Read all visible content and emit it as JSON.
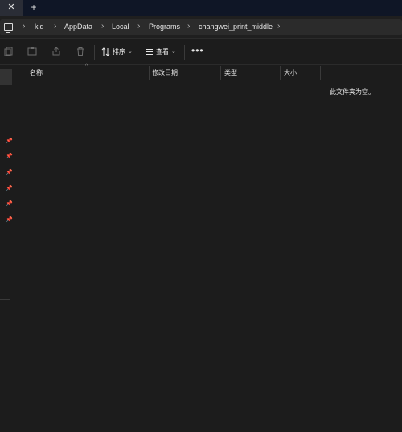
{
  "titlebar": {
    "close_glyph": "✕",
    "new_tab_glyph": "+"
  },
  "address": {
    "icon": "computer-icon",
    "separator": "›",
    "crumbs": [
      "kid",
      "AppData",
      "Local",
      "Programs",
      "changwei_print_middle"
    ]
  },
  "toolbar": {
    "icons": [
      "copy-icon",
      "paste-icon",
      "share-icon",
      "delete-icon"
    ],
    "sort_label": "排序",
    "view_label": "查看",
    "more_label": "•••",
    "caret": "⌄"
  },
  "nav": {
    "pins": [
      "📌",
      "📌",
      "📌",
      "📌",
      "📌",
      "📌"
    ]
  },
  "columns": {
    "name": "名称",
    "modified": "修改日期",
    "type": "类型",
    "size": "大小",
    "sort_glyph": "^"
  },
  "empty_message": "此文件夹为空。",
  "colors": {
    "background": "#1c1c1c",
    "titlebar": "#0f1626",
    "address_field": "#2b2b2b"
  }
}
